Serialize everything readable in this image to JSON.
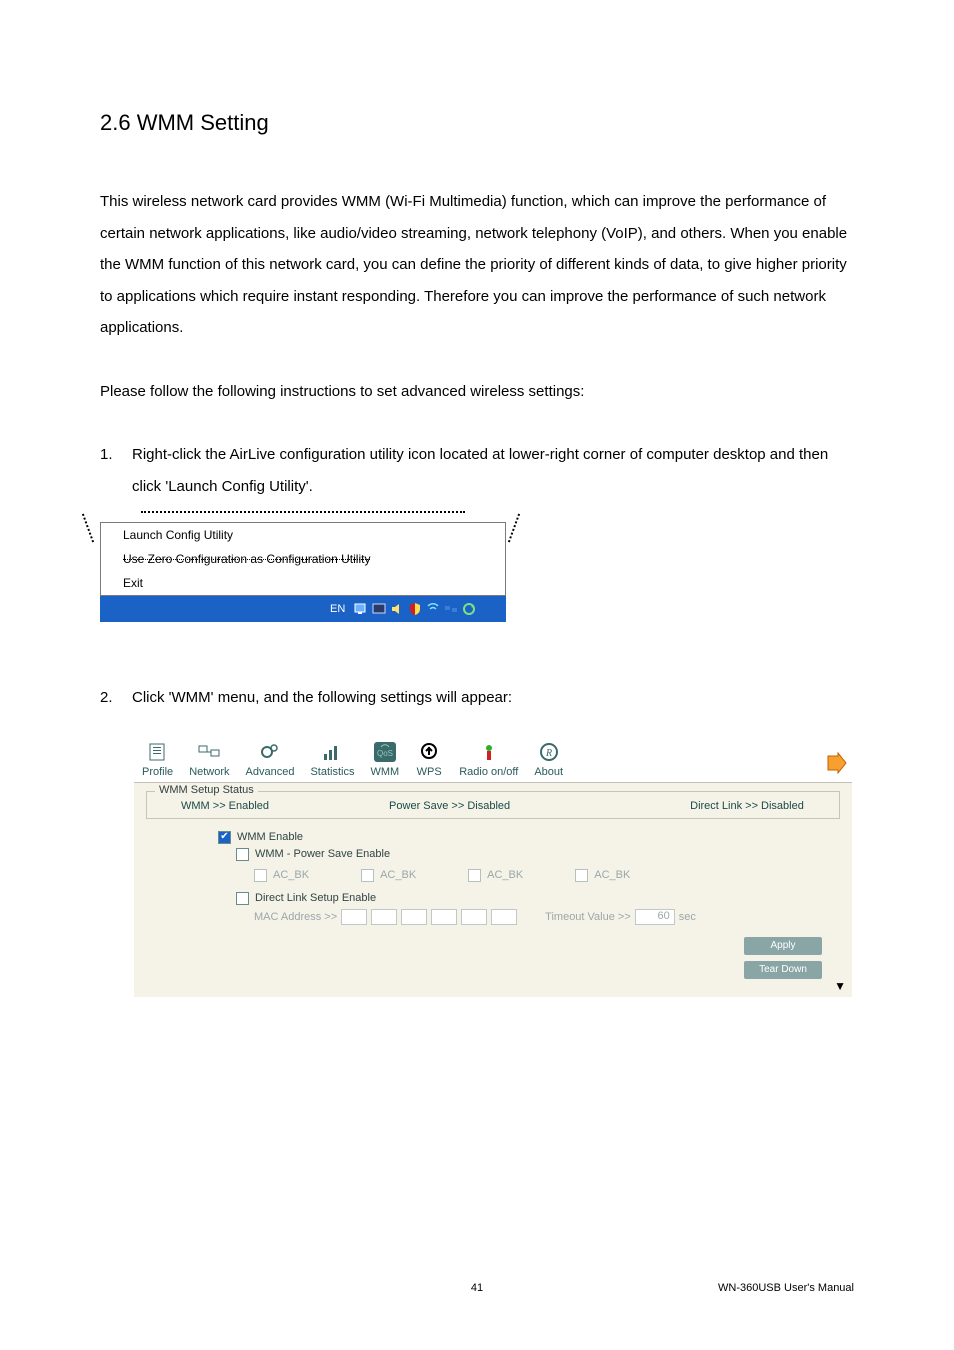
{
  "heading": "2.6 WMM Setting",
  "para1": "This wireless network card provides WMM (Wi-Fi Multimedia) function, which can improve the performance of certain network applications, like audio/video streaming, network telephony (VoIP), and others. When you enable the WMM function of this network card, you can define the priority of different kinds of data, to give higher priority to applications which require instant responding. Therefore you can improve the performance of such network applications.",
  "para2": "Please follow the following instructions to set advanced wireless settings:",
  "step1_num": "1.",
  "step1_body": "Right-click the AirLive configuration utility icon located at lower-right corner of computer desktop and then click 'Launch Config Utility'.",
  "ctx": {
    "item1": "Launch Config Utility",
    "item2": "Use Zero Configuration as Configuration Utility",
    "item3": "Exit",
    "lang": "EN"
  },
  "step2_num": "2.",
  "step2_body": "Click 'WMM' menu, and the following settings will appear:",
  "tabs": {
    "profile": "Profile",
    "network": "Network",
    "advanced": "Advanced",
    "statistics": "Statistics",
    "wmm": "WMM",
    "wps": "WPS",
    "radio": "Radio on/off",
    "about": "About"
  },
  "wmm": {
    "group_title": "WMM Setup Status",
    "status_wmm": "WMM >> Enabled",
    "status_ps": "Power Save >> Disabled",
    "status_dl": "Direct Link >> Disabled",
    "cb_wmm_enable": "WMM Enable",
    "cb_ps_enable": "WMM - Power Save Enable",
    "ac": "AC_BK",
    "cb_dl_enable": "Direct Link Setup Enable",
    "mac_label": "MAC Address >>",
    "timeout_label": "Timeout Value >>",
    "timeout_value": "60",
    "timeout_unit": "sec",
    "btn_apply": "Apply",
    "btn_teardown": "Tear Down"
  },
  "footer": {
    "page": "41",
    "manual": "WN-360USB  User's Manual"
  }
}
